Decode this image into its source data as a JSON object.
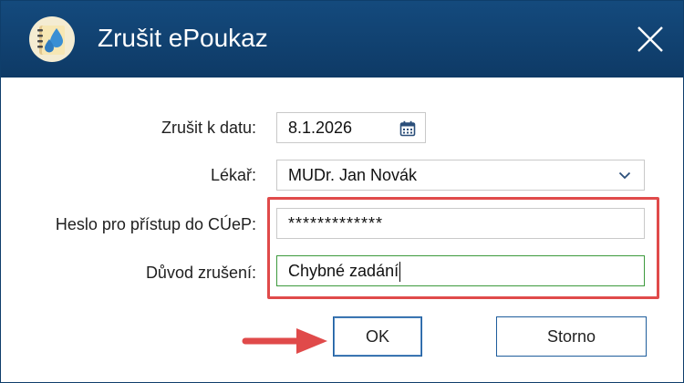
{
  "window": {
    "title": "Zrušit ePoukaz",
    "app_icon": "water-drops-icon",
    "close_icon": "close-icon"
  },
  "form": {
    "date": {
      "label": "Zrušit k datu:",
      "value": "8.1.2026",
      "icon": "calendar-icon"
    },
    "doctor": {
      "label": "Lékař:",
      "value": "MUDr. Jan Novák",
      "icon": "chevron-down-icon"
    },
    "password": {
      "label": "Heslo pro přístup do CÚeP:",
      "value": "*************"
    },
    "reason": {
      "label": "Důvod zrušení:",
      "value": "Chybné zadání"
    }
  },
  "buttons": {
    "ok": "OK",
    "cancel": "Storno"
  },
  "colors": {
    "titlebar": "#144a7d",
    "highlight": "#e04a4a",
    "active_border": "#3d9a3d",
    "button_border": "#1e5d9c"
  }
}
